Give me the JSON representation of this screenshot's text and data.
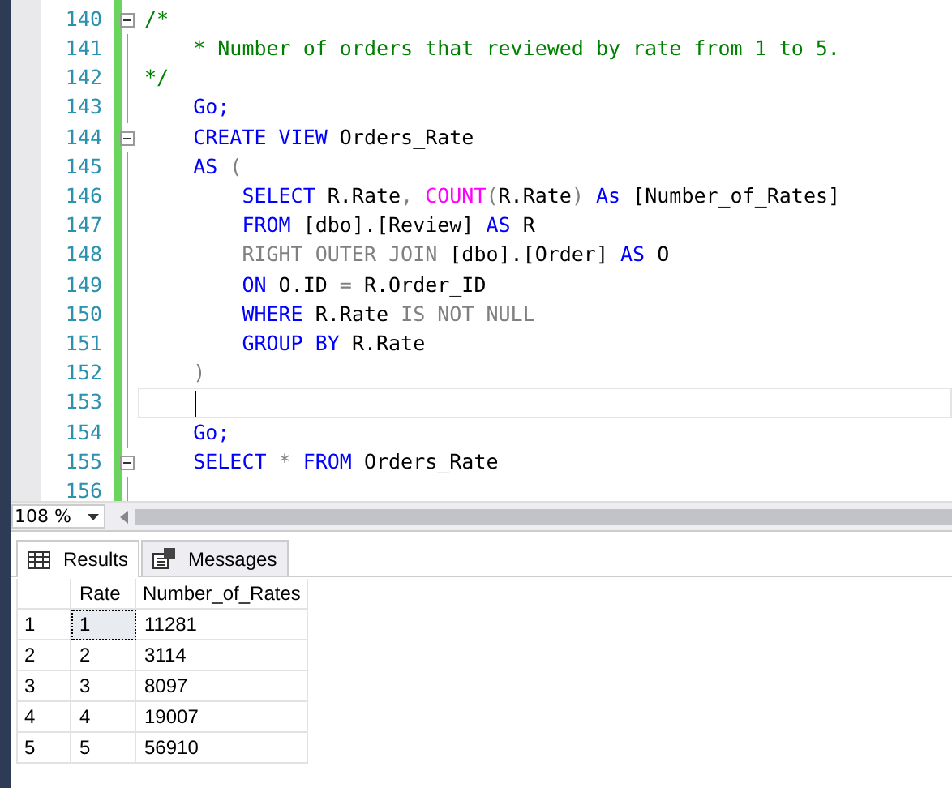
{
  "editor": {
    "lines": [
      {
        "number": "140",
        "foldable": true,
        "current": false,
        "tokens": [
          {
            "text": "/*",
            "kind": "comment"
          }
        ]
      },
      {
        "number": "141",
        "foldable": false,
        "current": false,
        "tokens": [
          {
            "text": "    * Number of orders that reviewed by rate from 1 to 5.",
            "kind": "comment"
          }
        ]
      },
      {
        "number": "142",
        "foldable": false,
        "current": false,
        "tokens": [
          {
            "text": "*/",
            "kind": "comment"
          }
        ]
      },
      {
        "number": "143",
        "foldable": false,
        "current": false,
        "tokens": [
          {
            "text": "    Go;",
            "kind": "keyword"
          }
        ]
      },
      {
        "number": "144",
        "foldable": true,
        "current": false,
        "tokens": [
          {
            "text": "    CREATE VIEW",
            "kind": "keyword"
          },
          {
            "text": " Orders_Rate",
            "kind": "plain"
          }
        ]
      },
      {
        "number": "145",
        "foldable": false,
        "current": false,
        "tokens": [
          {
            "text": "    AS",
            "kind": "keyword"
          },
          {
            "text": " (",
            "kind": "operator"
          }
        ]
      },
      {
        "number": "146",
        "foldable": false,
        "current": false,
        "tokens": [
          {
            "text": "        SELECT",
            "kind": "keyword"
          },
          {
            "text": " R.Rate",
            "kind": "plain"
          },
          {
            "text": ", ",
            "kind": "operator"
          },
          {
            "text": "COUNT",
            "kind": "function"
          },
          {
            "text": "(",
            "kind": "operator"
          },
          {
            "text": "R.Rate",
            "kind": "plain"
          },
          {
            "text": ") ",
            "kind": "operator"
          },
          {
            "text": "As",
            "kind": "keyword"
          },
          {
            "text": " [Number_of_Rates]",
            "kind": "plain"
          }
        ]
      },
      {
        "number": "147",
        "foldable": false,
        "current": false,
        "tokens": [
          {
            "text": "        FROM",
            "kind": "keyword"
          },
          {
            "text": " [dbo].[Review] ",
            "kind": "plain"
          },
          {
            "text": "AS",
            "kind": "keyword"
          },
          {
            "text": " R",
            "kind": "plain"
          }
        ]
      },
      {
        "number": "148",
        "foldable": false,
        "current": false,
        "tokens": [
          {
            "text": "        RIGHT OUTER JOIN",
            "kind": "operator"
          },
          {
            "text": " [dbo].[Order] ",
            "kind": "plain"
          },
          {
            "text": "AS",
            "kind": "keyword"
          },
          {
            "text": " O",
            "kind": "plain"
          }
        ]
      },
      {
        "number": "149",
        "foldable": false,
        "current": false,
        "tokens": [
          {
            "text": "        ON",
            "kind": "keyword"
          },
          {
            "text": " O.ID ",
            "kind": "plain"
          },
          {
            "text": "=",
            "kind": "operator"
          },
          {
            "text": " R.Order_ID",
            "kind": "plain"
          }
        ]
      },
      {
        "number": "150",
        "foldable": false,
        "current": false,
        "tokens": [
          {
            "text": "        WHERE",
            "kind": "keyword"
          },
          {
            "text": " R.Rate ",
            "kind": "plain"
          },
          {
            "text": "IS NOT NULL",
            "kind": "operator"
          }
        ]
      },
      {
        "number": "151",
        "foldable": false,
        "current": false,
        "tokens": [
          {
            "text": "        GROUP BY",
            "kind": "keyword"
          },
          {
            "text": " R.Rate",
            "kind": "plain"
          }
        ]
      },
      {
        "number": "152",
        "foldable": false,
        "current": false,
        "tokens": [
          {
            "text": "    )",
            "kind": "operator"
          }
        ]
      },
      {
        "number": "153",
        "foldable": false,
        "current": true
      },
      {
        "number": "154",
        "foldable": false,
        "current": false,
        "tokens": [
          {
            "text": "    Go;",
            "kind": "keyword"
          }
        ]
      },
      {
        "number": "155",
        "foldable": true,
        "current": false,
        "tokens": [
          {
            "text": "    SELECT",
            "kind": "keyword"
          },
          {
            "text": " * ",
            "kind": "operator"
          },
          {
            "text": "FROM",
            "kind": "keyword"
          },
          {
            "text": " Orders_Rate",
            "kind": "plain"
          }
        ]
      },
      {
        "number": "156",
        "foldable": false,
        "current": false
      }
    ]
  },
  "zoom": {
    "value": "108 %"
  },
  "tabs": [
    {
      "label": "Results",
      "kind": "grid",
      "selected": true
    },
    {
      "label": "Messages",
      "kind": "messages",
      "selected": false
    }
  ],
  "results": {
    "columns": [
      "Rate",
      "Number_of_Rates"
    ],
    "rows": [
      {
        "number": "1",
        "cells": [
          {
            "text": "1",
            "selected": true
          },
          {
            "text": "11281",
            "selected": false
          }
        ]
      },
      {
        "number": "2",
        "cells": [
          {
            "text": "2",
            "selected": false
          },
          {
            "text": "3114",
            "selected": false
          }
        ]
      },
      {
        "number": "3",
        "cells": [
          {
            "text": "3",
            "selected": false
          },
          {
            "text": "8097",
            "selected": false
          }
        ]
      },
      {
        "number": "4",
        "cells": [
          {
            "text": "4",
            "selected": false
          },
          {
            "text": "19007",
            "selected": false
          }
        ]
      },
      {
        "number": "5",
        "cells": [
          {
            "text": "5",
            "selected": false
          },
          {
            "text": "56910",
            "selected": false
          }
        ]
      }
    ]
  }
}
